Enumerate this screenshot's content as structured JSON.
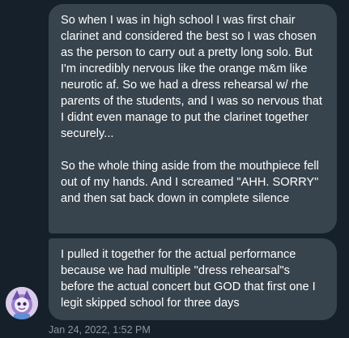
{
  "messages": [
    {
      "text": "So when I was in high school I was first chair clarinet and considered the best so I was chosen as the person to carry out a pretty long solo. But I'm incredibly nervous like the orange m&m like neurotic af. So we had a dress rehearsal w/ rhe parents of the students, and I was so nervous that I didnt even manage to put the clarinet together securely...\n\nSo the whole thing aside from the mouthpiece fell out of my hands. And I screamed \"AHH. SORRY\" and then sat back down in complete silence"
    },
    {
      "text": "I pulled it together for the actual performance because we had multiple \"dress rehearsal\"s before the actual concert but GOD that first one I legit skipped school for three days"
    }
  ],
  "timestamp": "Jan 24, 2022, 1:52 PM",
  "avatar_icon": "user-avatar-cartoon",
  "colors": {
    "background": "#15202b",
    "bubble": "#38444d",
    "text": "#ffffff",
    "timestamp": "#8b98a5"
  }
}
